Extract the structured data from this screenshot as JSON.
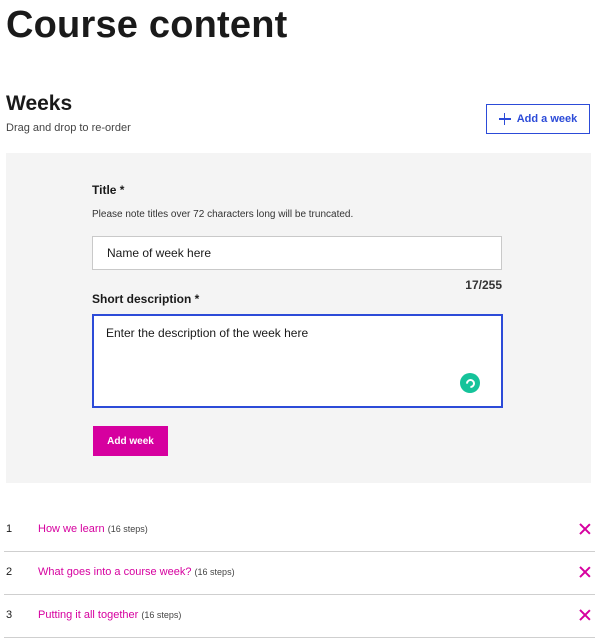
{
  "page": {
    "title": "Course content"
  },
  "weeks_section": {
    "title": "Weeks",
    "hint": "Drag and drop to re-order",
    "add_week_label": "Add a week"
  },
  "form": {
    "title_label": "Title *",
    "title_note": "Please note titles over 72 characters long will be truncated.",
    "title_value": "Name of week here",
    "char_count": "17/255",
    "description_label": "Short description *",
    "description_value": "Enter the description of the week here",
    "submit_label": "Add week"
  },
  "weeks": [
    {
      "number": "1",
      "name": "How we learn",
      "steps": "(16 steps)"
    },
    {
      "number": "2",
      "name": "What goes into a course week?",
      "steps": "(16 steps)"
    },
    {
      "number": "3",
      "name": "Putting it all together",
      "steps": "(16 steps)"
    }
  ],
  "icons": {
    "add": "plus-icon",
    "remove": "close-icon",
    "grammar": "grammarly-icon"
  },
  "colors": {
    "accent_blue": "#2c4bd8",
    "accent_magenta": "#d6009f",
    "panel_bg": "#f4f4f4",
    "grammar_green": "#15c39a"
  }
}
